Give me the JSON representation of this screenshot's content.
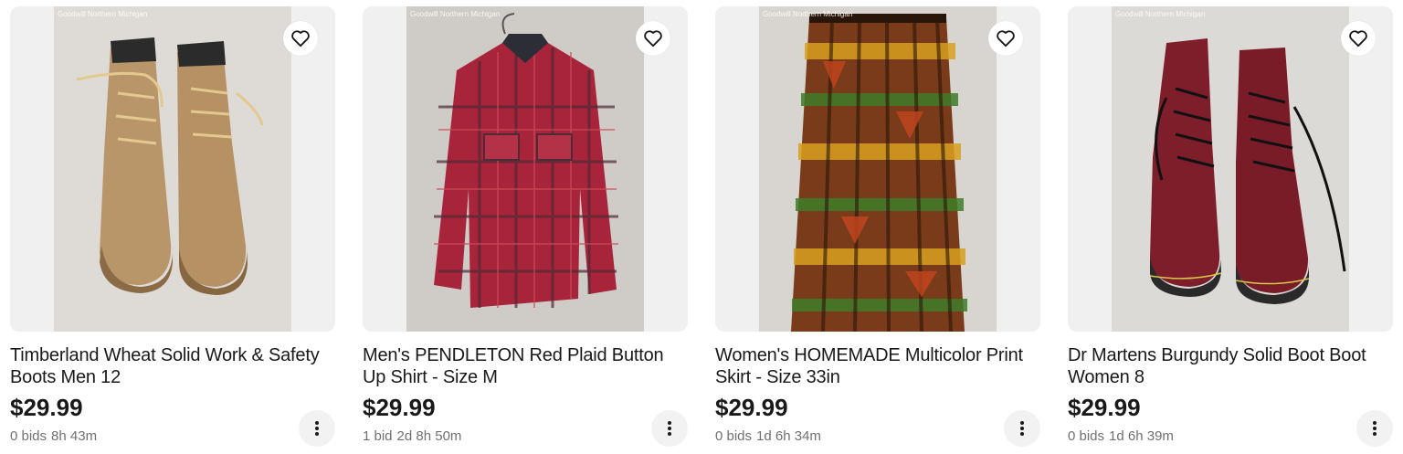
{
  "listings": [
    {
      "image_alt": "tan work boots",
      "watermark": "Goodwill Northern Michigan",
      "title": "Timberland Wheat Solid Work & Safety Boots Men 12",
      "price": "$29.99",
      "bids": "0 bids",
      "time_left": "8h 43m"
    },
    {
      "image_alt": "red plaid shirt",
      "watermark": "Goodwill Northern Michigan",
      "title": "Men's PENDLETON Red Plaid Button Up Shirt - Size M",
      "price": "$29.99",
      "bids": "1 bid",
      "time_left": "2d 8h 50m"
    },
    {
      "image_alt": "multicolor print skirt",
      "watermark": "Goodwill Northern Michigan",
      "title": "Women's HOMEMADE Multicolor Print Skirt - Size 33in",
      "price": "$29.99",
      "bids": "0 bids",
      "time_left": "1d 6h 34m"
    },
    {
      "image_alt": "burgundy boots",
      "watermark": "Goodwill Northern Michigan",
      "title": "Dr Martens Burgundy Solid Boot Boot Women 8",
      "price": "$29.99",
      "bids": "0 bids",
      "time_left": "1d 6h 39m"
    }
  ],
  "icons": {
    "watch": "heart-icon",
    "more": "kebab-menu-icon"
  },
  "colors": {
    "text": "#191919",
    "secondary_text": "#707070",
    "image_bg": "#f0f0f0"
  }
}
